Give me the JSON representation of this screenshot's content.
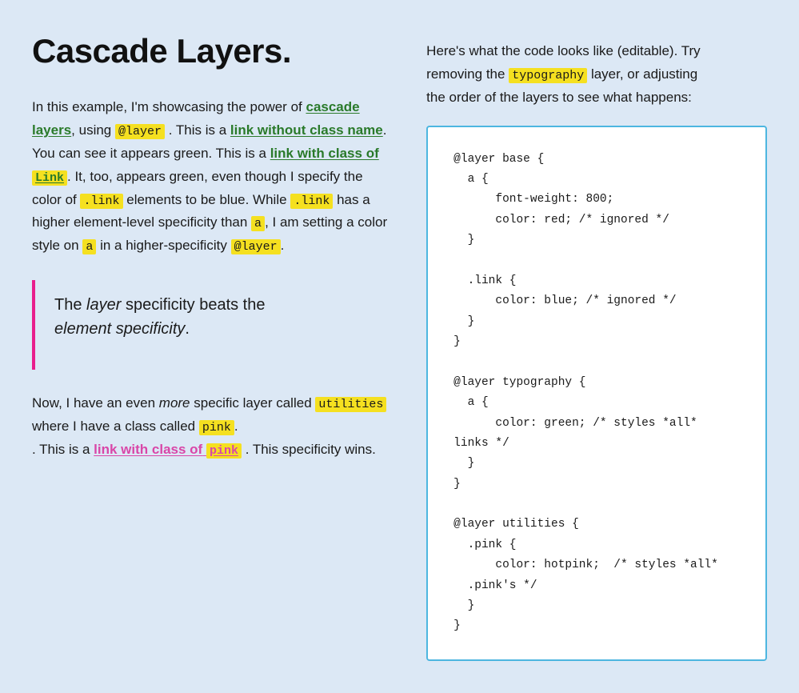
{
  "page": {
    "background": "#dce8f5"
  },
  "left": {
    "heading": "Cascade Layers.",
    "intro": "In this example, I'm showcasing the power of",
    "intro_link_text": "cascade layers",
    "intro_mid": ", using",
    "at_layer_badge": "@layer",
    "intro_end": ". This is a",
    "link_no_class_text": "link without class name",
    "p1_cont": ". You can see it appears green. This is a",
    "link_with_class_text": "link with class of",
    "link_badge": "Link",
    "p1_end": ". It, too, appears green, even though I specify the color of",
    "link_badge2": ".link",
    "p2_mid": "elements to be blue. While",
    "link_badge3": ".link",
    "p2_cont": "has a higher element-level specificity than",
    "a_badge": "a",
    "p2_cont2": ", I am setting a color style on",
    "a_badge2": "a",
    "p2_cont3": "in a higher-specificity",
    "at_layer_badge2": "@layer",
    "p2_end": ".",
    "blockquote_line1": "The",
    "blockquote_em1": "layer",
    "blockquote_mid": "specificity beats the",
    "blockquote_em2": "element specificity",
    "blockquote_end": ".",
    "p3_start": "Now, I have an even",
    "more_em": "more",
    "p3_mid": "specific layer called",
    "utilities_badge": "utilities",
    "p3_cont": "where I have a class called",
    "pink_badge": "pink",
    "p3_end": ". This is a",
    "link_pink_text": "link with class of",
    "pink_badge2": "pink",
    "p3_final": ". This specificity wins."
  },
  "right": {
    "intro_line1": "Here's what the code looks like (editable). Try",
    "intro_line2": "removing the",
    "typography_badge": "typography",
    "intro_line3": "layer, or adjusting",
    "intro_line4": "the order of the layers to see what happens:",
    "code": "@layer base {\n  a {\n      font-weight: 800;\n      color: red; /* ignored */\n  }\n\n  .link {\n      color: blue; /* ignored */\n  }\n}\n\n@layer typography {\n  a {\n      color: green; /* styles *all*\nlinks */\n  }\n}\n\n@layer utilities {\n  .pink {\n      color: hotpink;  /* styles *all*\n  .pink's */\n  }\n}"
  }
}
